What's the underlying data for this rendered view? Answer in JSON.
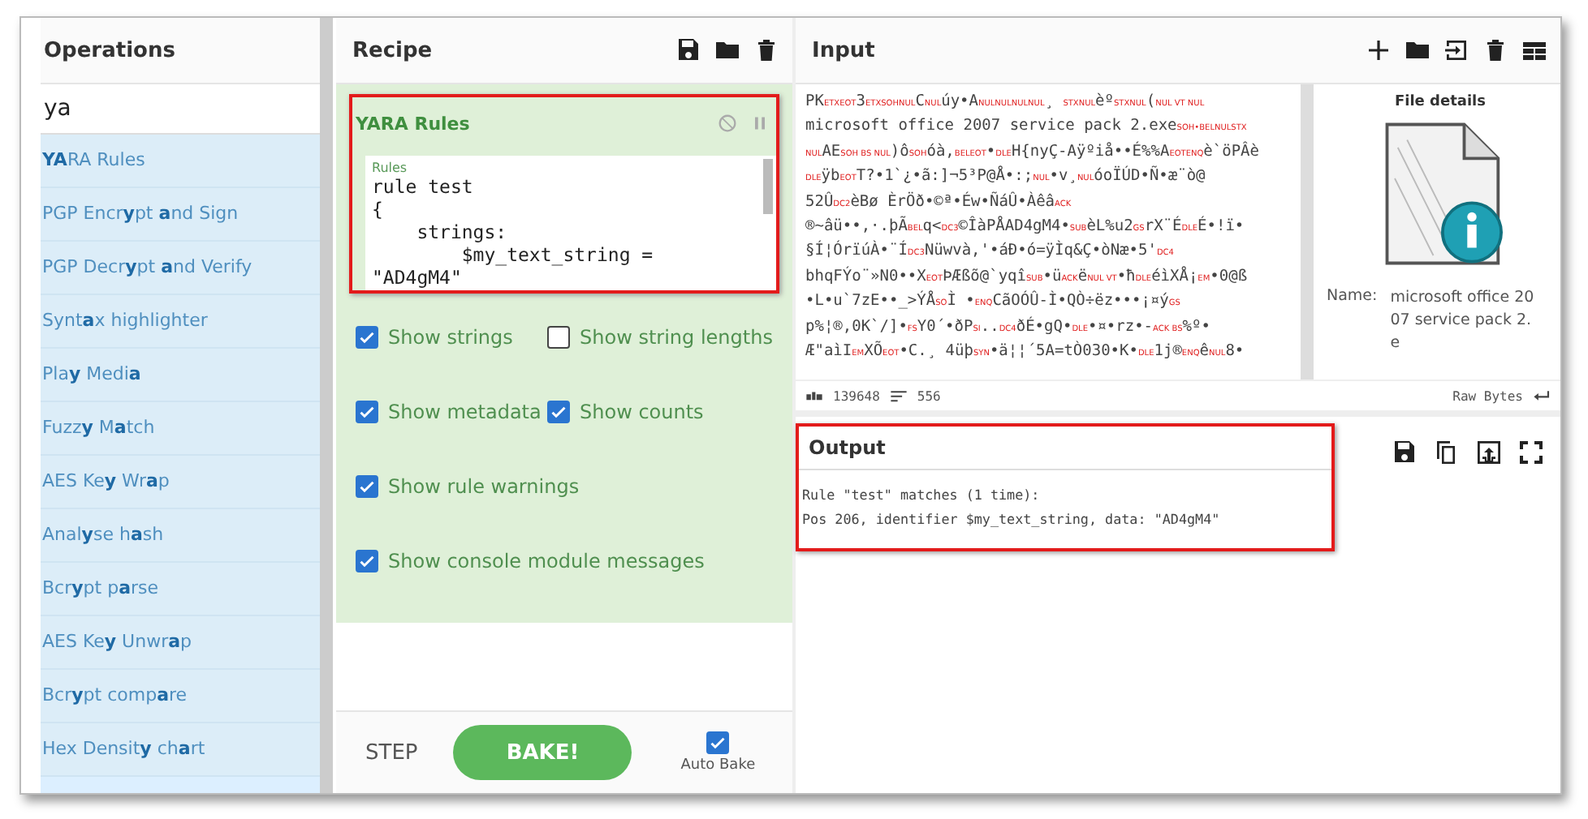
{
  "operations": {
    "title": "Operations",
    "search": {
      "value": "ya"
    },
    "items": [
      {
        "label": "**YA**RA Rules"
      },
      {
        "label": "PGP Encr**y**pt **a**nd Sign"
      },
      {
        "label": "PGP Decr**y**pt **a**nd Verify"
      },
      {
        "label": "Synt**a**x highlighter"
      },
      {
        "label": "Pla**y** Medi**a**"
      },
      {
        "label": "Fuzz**y** M**a**tch"
      },
      {
        "label": "AES Ke**y** Wr**a**p"
      },
      {
        "label": "Anal**y**se h**a**sh"
      },
      {
        "label": "Bcr**y**pt p**a**rse"
      },
      {
        "label": "AES Ke**y** Unwr**a**p"
      },
      {
        "label": "Bcr**y**pt comp**a**re"
      },
      {
        "label": "Hex Densit**y** ch**a**rt"
      }
    ]
  },
  "recipe": {
    "title": "Recipe",
    "operation": {
      "name": "YARA Rules",
      "highlighted": true,
      "disabled": false,
      "paused": false,
      "rules_label": "Rules",
      "rules_lines": [
        "rule test",
        "{",
        "    strings:",
        "        $my_text_string =",
        "\"AD4gM4\""
      ]
    },
    "options": [
      {
        "label": "Show strings",
        "checked": true
      },
      {
        "label": "Show string lengths",
        "checked": false
      },
      {
        "label": "Show metadata",
        "checked": true
      },
      {
        "label": "Show counts",
        "checked": true
      },
      {
        "label": "Show rule warnings",
        "checked": true
      },
      {
        "label": "Show console module messages",
        "checked": true
      }
    ],
    "step": "STEP",
    "bake": "BAKE!",
    "auto_bake": {
      "label": "Auto Bake",
      "checked": true
    }
  },
  "input": {
    "title": "Input",
    "lines": [
      [
        {
          "kind": "text",
          "s": "PK"
        },
        {
          "kind": "ctrl",
          "s": "ETXEOT"
        },
        {
          "kind": "text",
          "s": "3"
        },
        {
          "kind": "ctrl",
          "s": "ETXSOHNUL"
        },
        {
          "kind": "text",
          "s": "C"
        },
        {
          "kind": "ctrl",
          "s": "NUL"
        },
        {
          "kind": "text",
          "s": "úy•A"
        },
        {
          "kind": "ctrl",
          "s": "NULNULNULNUL"
        },
        {
          "kind": "text",
          "s": "¸ "
        },
        {
          "kind": "ctrl",
          "s": "STXNUL"
        },
        {
          "kind": "text",
          "s": "èº"
        },
        {
          "kind": "ctrl",
          "s": "STXNUL"
        },
        {
          "kind": "text",
          "s": "("
        },
        {
          "kind": "ctrl",
          "s": "NUL VT NUL"
        }
      ],
      [
        {
          "kind": "text",
          "s": "microsoft office 2007 service pack 2.exe"
        },
        {
          "kind": "ctrl",
          "s": "SOH•BELNULSTX"
        }
      ],
      [
        {
          "kind": "ctrl",
          "s": "NUL"
        },
        {
          "kind": "text",
          "s": "AE"
        },
        {
          "kind": "ctrl",
          "s": "SOH BS NUL"
        },
        {
          "kind": "text",
          "s": ")ô"
        },
        {
          "kind": "ctrl",
          "s": "SOH"
        },
        {
          "kind": "text",
          "s": "óà,"
        },
        {
          "kind": "ctrl",
          "s": "BELEOT"
        },
        {
          "kind": "text",
          "s": "•"
        },
        {
          "kind": "ctrl",
          "s": "DLE"
        },
        {
          "kind": "text",
          "s": "H{nyÇ-Aÿºiå••É%%A"
        },
        {
          "kind": "ctrl",
          "s": "EOTENQ"
        },
        {
          "kind": "text",
          "s": "è`öPÂè"
        }
      ],
      [
        {
          "kind": "ctrl",
          "s": "DLE"
        },
        {
          "kind": "text",
          "s": "ÿb"
        },
        {
          "kind": "ctrl",
          "s": "EOT"
        },
        {
          "kind": "text",
          "s": "T?•1`¿•ã:]¬5³P@Å•:;"
        },
        {
          "kind": "ctrl",
          "s": "NUL"
        },
        {
          "kind": "text",
          "s": "•v¸"
        },
        {
          "kind": "ctrl",
          "s": "NUL"
        },
        {
          "kind": "text",
          "s": "óoÏÚD•Ñ•æ¨ò@"
        }
      ],
      [
        {
          "kind": "text",
          "s": "52Û"
        },
        {
          "kind": "ctrl",
          "s": "DC2"
        },
        {
          "kind": "text",
          "s": "èBø ÈrÖð•©ª•Éw•ÑáÛ•Àêâ"
        },
        {
          "kind": "ctrl",
          "s": "ACK"
        }
      ],
      [
        {
          "kind": "text",
          "s": "®~âü••,·.þÃ"
        },
        {
          "kind": "ctrl",
          "s": "BEL"
        },
        {
          "kind": "text",
          "s": "q<"
        },
        {
          "kind": "ctrl",
          "s": "DC3"
        },
        {
          "kind": "text",
          "s": "©ÎàPÅAD4gM4•"
        },
        {
          "kind": "ctrl",
          "s": "SUB"
        },
        {
          "kind": "text",
          "s": "èL%u2"
        },
        {
          "kind": "ctrl",
          "s": "GS"
        },
        {
          "kind": "text",
          "s": "rX¨É"
        },
        {
          "kind": "ctrl",
          "s": "DLE"
        },
        {
          "kind": "text",
          "s": "É•!ï•"
        }
      ],
      [
        {
          "kind": "text",
          "s": "§Í¦ÓrïúÀ•¨Í"
        },
        {
          "kind": "ctrl",
          "s": "DC3"
        },
        {
          "kind": "text",
          "s": "Nüwvà,'•áÐ•ó=ÿÌq&Ç•òNæ•5'"
        },
        {
          "kind": "ctrl",
          "s": "DC4"
        }
      ],
      [
        {
          "kind": "text",
          "s": "bhqFÝo¨»N0••X"
        },
        {
          "kind": "ctrl",
          "s": "EOT"
        },
        {
          "kind": "text",
          "s": "ÞÆßõ@`yqî"
        },
        {
          "kind": "ctrl",
          "s": "SUB"
        },
        {
          "kind": "text",
          "s": "•ü"
        },
        {
          "kind": "ctrl",
          "s": "ACK"
        },
        {
          "kind": "text",
          "s": "ë"
        },
        {
          "kind": "ctrl",
          "s": "NUL VT"
        },
        {
          "kind": "text",
          "s": "•ħ"
        },
        {
          "kind": "ctrl",
          "s": "DLE"
        },
        {
          "kind": "text",
          "s": "éìXÅ¡"
        },
        {
          "kind": "ctrl",
          "s": "EM"
        },
        {
          "kind": "text",
          "s": "•0@ß"
        }
      ],
      [
        {
          "kind": "text",
          "s": "•L•u`7zE••_>ÝÅ"
        },
        {
          "kind": "ctrl",
          "s": "SO"
        },
        {
          "kind": "text",
          "s": "Ì    •"
        },
        {
          "kind": "ctrl",
          "s": "ENQ"
        },
        {
          "kind": "text",
          "s": "CãOÓÛ-Ì•QÒ÷ëz•••¡¤ý"
        },
        {
          "kind": "ctrl",
          "s": "GS"
        }
      ],
      [
        {
          "kind": "text",
          "s": "p%¦®,0K`/]•"
        },
        {
          "kind": "ctrl",
          "s": "FS"
        },
        {
          "kind": "text",
          "s": "Y0´•ðP"
        },
        {
          "kind": "ctrl",
          "s": "SI"
        },
        {
          "kind": "text",
          "s": ".."
        },
        {
          "kind": "ctrl",
          "s": "DC4"
        },
        {
          "kind": "text",
          "s": "ðÉ•gQ•"
        },
        {
          "kind": "ctrl",
          "s": "DLE"
        },
        {
          "kind": "text",
          "s": "•¤•rz•-"
        },
        {
          "kind": "ctrl",
          "s": "ACK BS"
        },
        {
          "kind": "text",
          "s": "%º•"
        }
      ],
      [
        {
          "kind": "text",
          "s": "Æ\"aìI"
        },
        {
          "kind": "ctrl",
          "s": "EM"
        },
        {
          "kind": "text",
          "s": "XÕ"
        },
        {
          "kind": "ctrl",
          "s": "EOT"
        },
        {
          "kind": "text",
          "s": "•C.¸ 4üþ"
        },
        {
          "kind": "ctrl",
          "s": "SYN"
        },
        {
          "kind": "text",
          "s": "•ä¦¦´5A=tÒ030•K•"
        },
        {
          "kind": "ctrl",
          "s": "DLE"
        },
        {
          "kind": "text",
          "s": "1j®"
        },
        {
          "kind": "ctrl",
          "s": "ENQ"
        },
        {
          "kind": "text",
          "s": "ê"
        },
        {
          "kind": "ctrl",
          "s": "NUL"
        },
        {
          "kind": "text",
          "s": "8•"
        }
      ]
    ],
    "length": "139648",
    "line_count": "556",
    "encoding": "Raw Bytes",
    "file_details": {
      "title": "File details",
      "name_label": "Name:",
      "name_value": "microsoft office 2007 service pack 2.e"
    }
  },
  "output": {
    "title": "Output",
    "highlighted": true,
    "lines": [
      "Rule \"test\" matches (1 time):",
      "Pos 206, identifier $my_text_string, data: \"AD4gM4\""
    ]
  }
}
